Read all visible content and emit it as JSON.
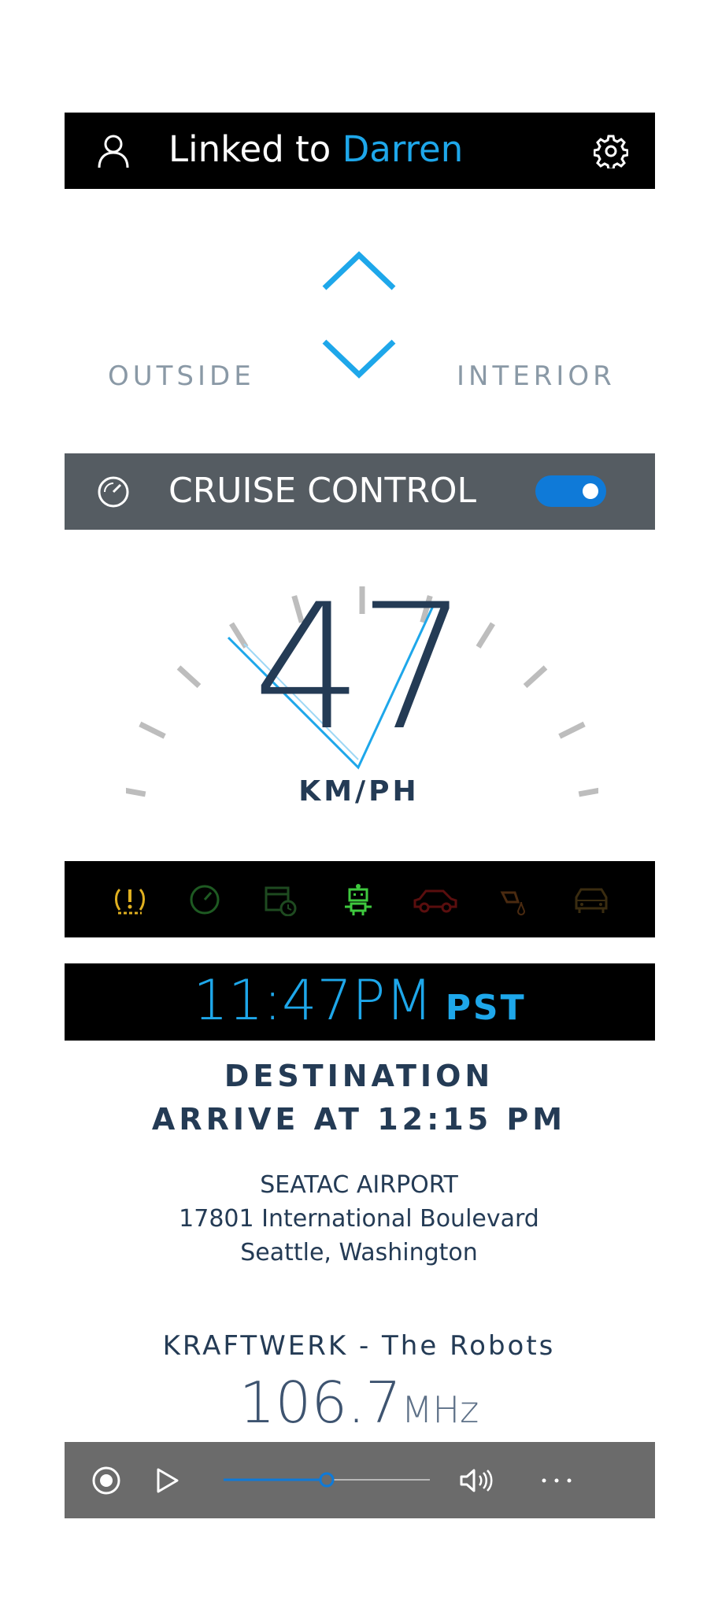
{
  "header": {
    "linked_prefix": "Linked to",
    "linked_name": "Darren"
  },
  "view_switch": {
    "left_label": "OUTSIDE",
    "right_label": "INTERIOR"
  },
  "cruise": {
    "label": "CRUISE CONTROL",
    "enabled": true
  },
  "speed": {
    "value": "47",
    "unit": "KM/PH"
  },
  "warning_icons": [
    {
      "name": "tire-pressure-icon",
      "color": "#e0b020"
    },
    {
      "name": "speedometer-icon",
      "color": "#1e5a22"
    },
    {
      "name": "calendar-clock-icon",
      "color": "#1e4a20"
    },
    {
      "name": "robot-icon",
      "color": "#3ec83e"
    },
    {
      "name": "car-icon",
      "color": "#5a0e0e"
    },
    {
      "name": "oil-fill-icon",
      "color": "#4a2a10"
    },
    {
      "name": "car-front-icon",
      "color": "#3a2c10"
    }
  ],
  "clock": {
    "time": "11:47PM",
    "zone": "PST"
  },
  "destination": {
    "title": "DESTINATION",
    "arrive": "ARRIVE AT 12:15 PM",
    "name": "SEATAC AIRPORT",
    "street": "17801 International Boulevard",
    "city": "Seattle, Washington"
  },
  "radio": {
    "track": "KRAFTWERK - The Robots",
    "frequency": "106.7",
    "unit": "MHz"
  },
  "media": {
    "progress": 0.5
  },
  "colors": {
    "accent": "#1ea7ea",
    "navy": "#243b55",
    "toggle": "#0f7ad8"
  }
}
